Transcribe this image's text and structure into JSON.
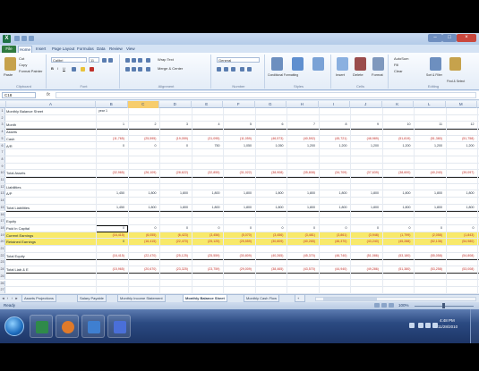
{
  "colors": {
    "accent_file_tab": "#2f7a3f",
    "highlight_row": "#f8e96a",
    "negative": "#c0302a",
    "selected_col": "#f7cd6c",
    "taskbar": "#2b4a82"
  },
  "window": {
    "title": "",
    "app_icon_letter": "X"
  },
  "ribbon_tabs": [
    "File",
    "Home",
    "Insert",
    "Page Layout",
    "Formulas",
    "Data",
    "Review",
    "View"
  ],
  "ribbon": {
    "clipboard": {
      "cut": "Cut",
      "copy": "Copy",
      "format_painter": "Format Painter",
      "paste": "Paste",
      "label": "Clipboard"
    },
    "font": {
      "name": "Calibri",
      "size": "11",
      "label": "Font"
    },
    "alignment": {
      "wrap": "Wrap Text",
      "merge": "Merge & Center",
      "label": "Alignment"
    },
    "number": {
      "format": "General",
      "label": "Number"
    },
    "styles": {
      "conditional": "Conditional Formatting",
      "format_table": "Format as Table",
      "cell_styles": "Cell Styles",
      "label": "Styles"
    },
    "cells": {
      "insert": "Insert",
      "delete": "Delete",
      "format": "Format",
      "label": "Cells"
    },
    "editing": {
      "autosum": "AutoSum",
      "fill": "Fill",
      "clear": "Clear",
      "sort": "Sort & Filter",
      "find": "Find & Select",
      "label": "Editing"
    }
  },
  "formula_bar": {
    "name_box": "C18",
    "fx": "fx"
  },
  "columns": [
    "A",
    "B",
    "C",
    "D",
    "E",
    "F",
    "G",
    "H",
    "I",
    "J",
    "K",
    "L",
    "M",
    "N"
  ],
  "rows": [
    {
      "n": "1",
      "label": "Monthly Balance Sheet",
      "type": "hdr",
      "values": [
        "year 1"
      ]
    },
    {
      "n": "2",
      "label": "",
      "type": "blank",
      "values": []
    },
    {
      "n": "3",
      "label": "Month",
      "type": "months",
      "values": [
        "1",
        "2",
        "3",
        "4",
        "5",
        "6",
        "7",
        "8",
        "9",
        "10",
        "11",
        "12"
      ]
    },
    {
      "n": "4",
      "label": "Assets",
      "type": "blank",
      "values": []
    },
    {
      "n": "5",
      "label": "Cash",
      "type": "neg",
      "values": [
        "(11,765)",
        "(25,595)",
        "(19,059)",
        "(31,095)",
        "(11,059)",
        "(46,573)",
        "(40,592)",
        "(45,721)",
        "(48,989)",
        "(51,819)",
        "(51,380)",
        "(51,758)"
      ]
    },
    {
      "n": "6",
      "label": "A/R",
      "type": "pos",
      "values": [
        "0",
        "0",
        "0",
        "750",
        "1,050",
        "1,050",
        "1,200",
        "1,200",
        "1,200",
        "1,200",
        "1,200",
        "1,200"
      ]
    },
    {
      "n": "7",
      "label": "",
      "type": "blank",
      "values": []
    },
    {
      "n": "8",
      "label": "",
      "type": "blank",
      "values": []
    },
    {
      "n": "9",
      "label": "",
      "type": "blank",
      "values": []
    },
    {
      "n": "10",
      "label": "Total Assets",
      "type": "neg",
      "values": [
        "(32,965)",
        "(26,109)",
        "(28,622)",
        "(32,855)",
        "(31,022)",
        "(38,908)",
        "(35,808)",
        "(34,709)",
        "(37,639)",
        "(38,600)",
        "(40,240)",
        "(39,097)"
      ]
    },
    {
      "n": "11",
      "label": "",
      "type": "blank",
      "values": []
    },
    {
      "n": "12",
      "label": "Liabilities",
      "type": "blank",
      "values": []
    },
    {
      "n": "13",
      "label": "A/P",
      "type": "pos",
      "values": [
        "1,450",
        "1,800",
        "1,800",
        "1,800",
        "1,800",
        "1,800",
        "1,800",
        "1,800",
        "1,800",
        "1,800",
        "1,800",
        "1,800"
      ]
    },
    {
      "n": "14",
      "label": "",
      "type": "blank",
      "values": []
    },
    {
      "n": "15",
      "label": "Total Liabilities",
      "type": "pos",
      "values": [
        "1,450",
        "1,800",
        "1,800",
        "1,800",
        "1,800",
        "1,800",
        "1,800",
        "1,800",
        "1,800",
        "1,800",
        "1,800",
        "1,800"
      ]
    },
    {
      "n": "16",
      "label": "",
      "type": "blank",
      "values": []
    },
    {
      "n": "17",
      "label": "Equity",
      "type": "blank",
      "values": []
    },
    {
      "n": "18",
      "label": "Paid In Capital",
      "type": "pos",
      "values": [
        "0",
        "0",
        "0",
        "0",
        "0",
        "0",
        "0",
        "0",
        "0",
        "0",
        "0",
        "0"
      ]
    },
    {
      "n": "19",
      "label": "Current Earnings",
      "type": "neg",
      "values": [
        "(16,415)",
        "(6,055)",
        "(6,423)",
        "(3,456)",
        "(5,070)",
        "(3,456)",
        "(3,481)",
        "(3,861)",
        "(3,948)",
        "(1,799)",
        "(2,058)",
        "(1,843)"
      ],
      "highlight": true
    },
    {
      "n": "20",
      "label": "Retained Earnings",
      "type": "neg",
      "values": [
        "0",
        "(16,415)",
        "(22,470)",
        "(25,125)",
        "(25,559)",
        "(30,809)",
        "(40,265)",
        "(46,370)",
        "(43,240)",
        "(45,288)",
        "(52,136)",
        "(54,980)"
      ],
      "highlight": true
    },
    {
      "n": "21",
      "label": "",
      "type": "blank",
      "values": []
    },
    {
      "n": "22",
      "label": "Total Equity",
      "type": "neg",
      "values": [
        "(16,415)",
        "(22,470)",
        "(25,125)",
        "(25,559)",
        "(30,809)",
        "(40,265)",
        "(45,370)",
        "(46,740)",
        "(51,086)",
        "(53,180)",
        "(55,058)",
        "(54,808)"
      ]
    },
    {
      "n": "23",
      "label": "",
      "type": "blank",
      "values": []
    },
    {
      "n": "24",
      "label": "Total Liab & E",
      "type": "neg",
      "values": [
        "(15,965)",
        "(20,670)",
        "(23,325)",
        "(23,759)",
        "(29,009)",
        "(38,465)",
        "(43,570)",
        "(44,940)",
        "(49,286)",
        "(51,380)",
        "(53,258)",
        "(53,008)"
      ]
    },
    {
      "n": "25",
      "label": "",
      "type": "blank",
      "values": []
    },
    {
      "n": "26",
      "label": "",
      "type": "blank",
      "values": []
    },
    {
      "n": "27",
      "label": "",
      "type": "blank",
      "values": []
    }
  ],
  "active_cell_value": "0",
  "sheet_tabs": [
    "Assets Projections",
    "Salary Payable",
    "Monthly Income Statement",
    "Monthly Balance Sheet",
    "Monthly Cash Flow"
  ],
  "active_sheet": "Monthly Balance Sheet",
  "status": {
    "ready": "Ready",
    "zoom": "100%"
  },
  "clock": {
    "time": "4:48 PM",
    "date": "11/28/2010"
  }
}
